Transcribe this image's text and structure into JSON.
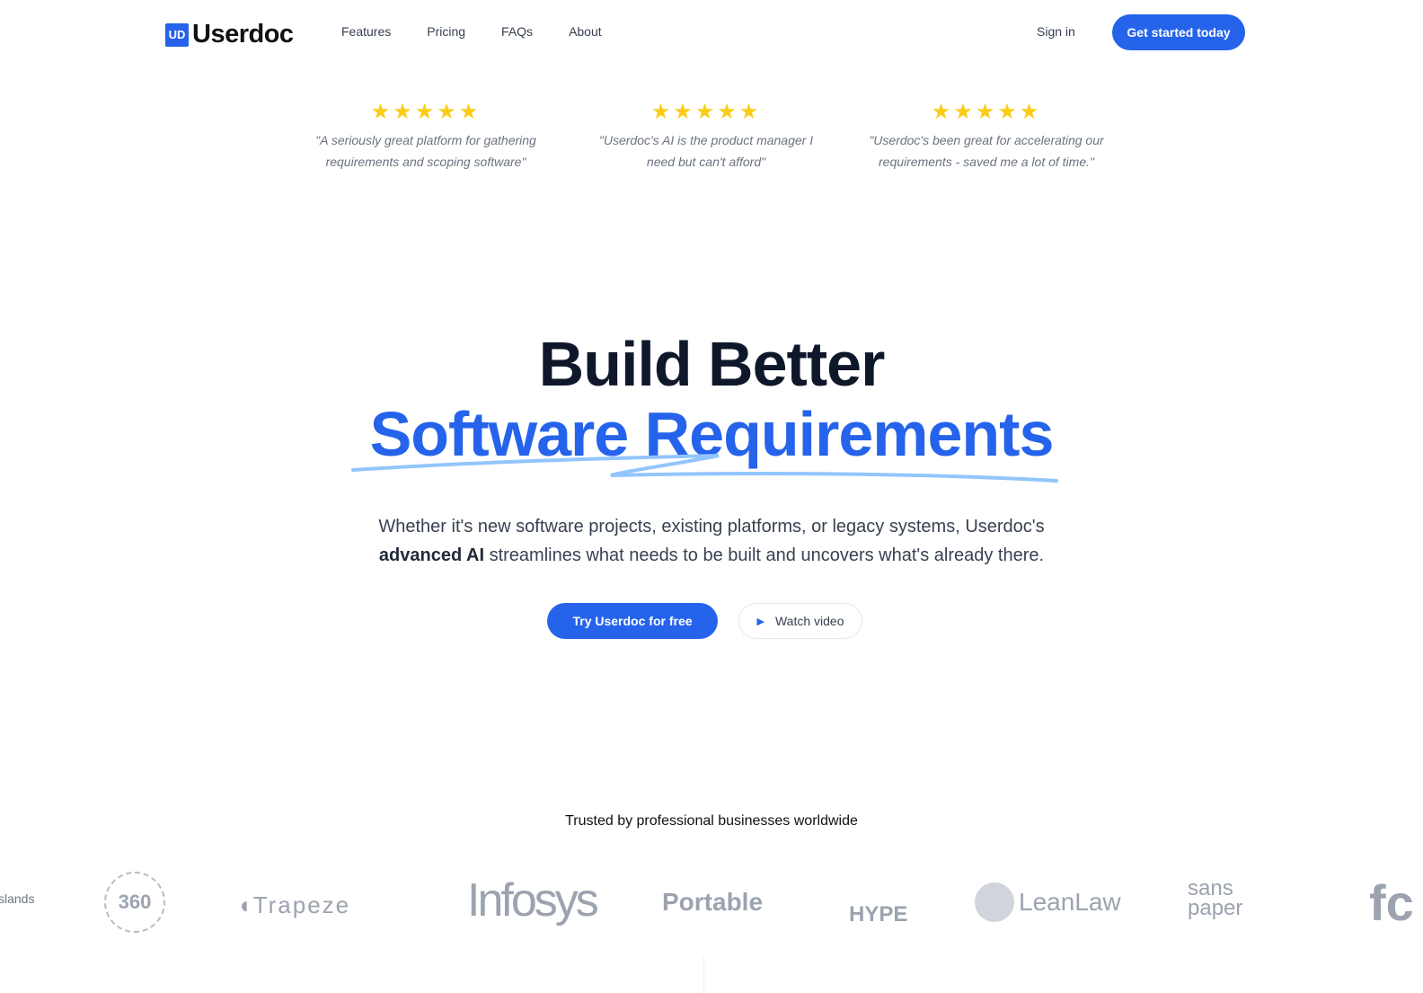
{
  "nav": {
    "logo_badge": "UD",
    "logo_text": "Userdoc",
    "links": [
      "Features",
      "Pricing",
      "FAQs",
      "About"
    ],
    "sign_in": "Sign in",
    "cta": "Get started today"
  },
  "reviews": [
    {
      "stars": 5,
      "quote": "\"A seriously great platform for gathering requirements and scoping software\""
    },
    {
      "stars": 5,
      "quote": "\"Userdoc's AI is the product manager I need but can't afford\""
    },
    {
      "stars": 5,
      "quote": "\"Userdoc's been great for accelerating our requirements - saved me a lot of time.\""
    }
  ],
  "hero": {
    "line1": "Build Better",
    "line2": "Software Requirements",
    "sub_pre": "Whether it's new software projects, existing platforms, or legacy systems, Userdoc's",
    "sub_bold": "advanced AI",
    "sub_post": "streamlines what needs to be built and uncovers what's already there.",
    "primary": "Try Userdoc for free",
    "secondary": "Watch video"
  },
  "trusted": {
    "title": "Trusted by professional businesses worldwide",
    "logos": [
      "slands",
      "360",
      "Trapeze",
      "Infosys",
      "Portable",
      "HYPE",
      "LeanLaw",
      "sans paper",
      "fc"
    ]
  },
  "colors": {
    "accent": "#2563eb",
    "star": "#facc15"
  }
}
